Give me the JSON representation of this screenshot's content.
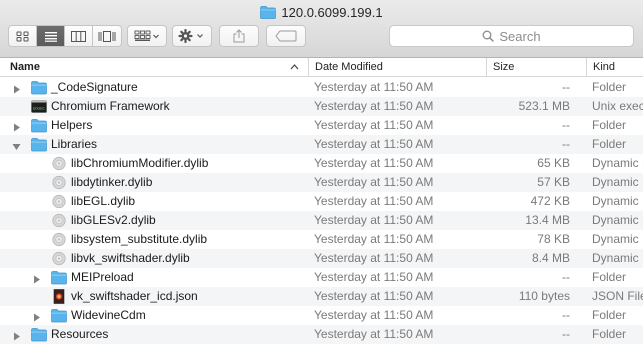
{
  "window": {
    "title": "120.0.6099.199.1"
  },
  "toolbar": {
    "view_buttons": [
      "icon-view",
      "list-view",
      "column-view",
      "cover-flow-view"
    ],
    "search_placeholder": "Search"
  },
  "columns": {
    "name": "Name",
    "date": "Date Modified",
    "size": "Size",
    "kind": "Kind"
  },
  "rows": [
    {
      "name": "_CodeSignature",
      "date": "Yesterday at 11:50 AM",
      "size": "--",
      "kind": "Folder",
      "icon": "folder-icon",
      "depth": 0,
      "disclosure": "collapsed"
    },
    {
      "name": "Chromium Framework",
      "date": "Yesterday at 11:50 AM",
      "size": "523.1 MB",
      "kind": "Unix executable",
      "icon": "unix-executable-icon",
      "depth": 0,
      "disclosure": "none"
    },
    {
      "name": "Helpers",
      "date": "Yesterday at 11:50 AM",
      "size": "--",
      "kind": "Folder",
      "icon": "folder-icon",
      "depth": 0,
      "disclosure": "collapsed"
    },
    {
      "name": "Libraries",
      "date": "Yesterday at 11:50 AM",
      "size": "--",
      "kind": "Folder",
      "icon": "folder-icon",
      "depth": 0,
      "disclosure": "expanded"
    },
    {
      "name": "libChromiumModifier.dylib",
      "date": "Yesterday at 11:50 AM",
      "size": "65 KB",
      "kind": "Dynamic Library",
      "icon": "dylib-icon",
      "depth": 1,
      "disclosure": "none"
    },
    {
      "name": "libdytinker.dylib",
      "date": "Yesterday at 11:50 AM",
      "size": "57 KB",
      "kind": "Dynamic Library",
      "icon": "dylib-icon",
      "depth": 1,
      "disclosure": "none"
    },
    {
      "name": "libEGL.dylib",
      "date": "Yesterday at 11:50 AM",
      "size": "472 KB",
      "kind": "Dynamic Library",
      "icon": "dylib-icon",
      "depth": 1,
      "disclosure": "none"
    },
    {
      "name": "libGLESv2.dylib",
      "date": "Yesterday at 11:50 AM",
      "size": "13.4 MB",
      "kind": "Dynamic Library",
      "icon": "dylib-icon",
      "depth": 1,
      "disclosure": "none"
    },
    {
      "name": "libsystem_substitute.dylib",
      "date": "Yesterday at 11:50 AM",
      "size": "78 KB",
      "kind": "Dynamic Library",
      "icon": "dylib-icon",
      "depth": 1,
      "disclosure": "none"
    },
    {
      "name": "libvk_swiftshader.dylib",
      "date": "Yesterday at 11:50 AM",
      "size": "8.4 MB",
      "kind": "Dynamic Library",
      "icon": "dylib-icon",
      "depth": 1,
      "disclosure": "none"
    },
    {
      "name": "MEIPreload",
      "date": "Yesterday at 11:50 AM",
      "size": "--",
      "kind": "Folder",
      "icon": "folder-icon",
      "depth": 1,
      "disclosure": "collapsed"
    },
    {
      "name": "vk_swiftshader_icd.json",
      "date": "Yesterday at 11:50 AM",
      "size": "110 bytes",
      "kind": "JSON File",
      "icon": "json-file-icon",
      "depth": 1,
      "disclosure": "none"
    },
    {
      "name": "WidevineCdm",
      "date": "Yesterday at 11:50 AM",
      "size": "--",
      "kind": "Folder",
      "icon": "folder-icon",
      "depth": 1,
      "disclosure": "collapsed"
    },
    {
      "name": "Resources",
      "date": "Yesterday at 11:50 AM",
      "size": "--",
      "kind": "Folder",
      "icon": "folder-icon",
      "depth": 0,
      "disclosure": "collapsed"
    }
  ],
  "colors": {
    "folder": "#5ab4ec",
    "alt_row": "#f3f5f7",
    "secondary_text": "#7a7a7a"
  }
}
